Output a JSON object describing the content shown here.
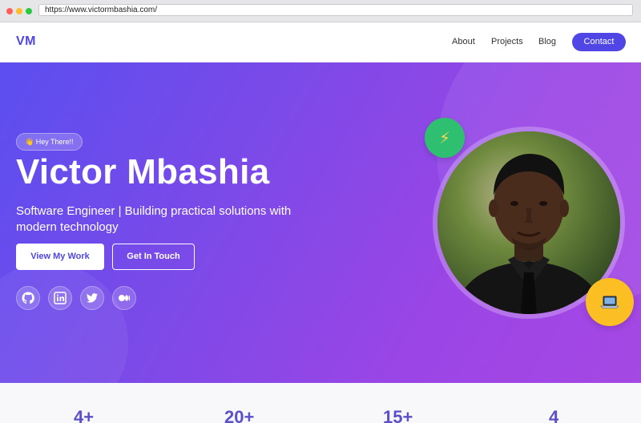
{
  "browser": {
    "url": "https://www.victormbashia.com/"
  },
  "nav": {
    "logo": "VM",
    "links": [
      {
        "label": "About"
      },
      {
        "label": "Projects"
      },
      {
        "label": "Blog"
      }
    ],
    "contact_label": "Contact"
  },
  "hero": {
    "badge": "👋 Hey There!!",
    "name": "Victor Mbashia",
    "subtitle": "Software Engineer | Building practical solutions with modern technology",
    "primary_button": "View My Work",
    "secondary_button": "Get In Touch",
    "social_icons": [
      "github-icon",
      "linkedin-icon",
      "twitter-icon",
      "medium-icon"
    ],
    "float_icons": {
      "top": "lightning-icon",
      "bottom": "laptop-icon"
    }
  },
  "stats": [
    {
      "value": "4+"
    },
    {
      "value": "20+"
    },
    {
      "value": "15+"
    },
    {
      "value": "4"
    }
  ],
  "colors": {
    "accent": "#4f46e5",
    "hero_gradient_start": "#5b4ef0",
    "hero_gradient_end": "#a548e4",
    "green_badge": "#2fbf71",
    "yellow_badge": "#fbbf24"
  }
}
